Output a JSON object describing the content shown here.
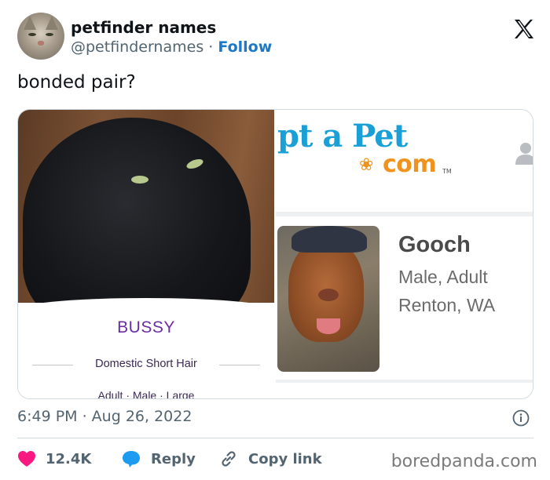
{
  "header": {
    "display_name": "petfinder names",
    "handle": "@petfindernames",
    "separator": "·",
    "follow_label": "Follow"
  },
  "tweet": {
    "text": "bonded pair?"
  },
  "media": {
    "left": {
      "pet_name": "BUSSY",
      "breed": "Domestic Short Hair",
      "attributes": "Adult  ·  Male  ·  Large"
    },
    "right": {
      "brand_partial": "pt a Pet",
      "brand_com": "com",
      "brand_tm": "TM",
      "pet_name": "Gooch",
      "pet_sex_age": "Male, Adult",
      "pet_location": "Renton, WA"
    }
  },
  "footer": {
    "timestamp": "6:49 PM · Aug 26, 2022",
    "likes_count": "12.4K",
    "reply_label": "Reply",
    "copy_link_label": "Copy link",
    "watermark": "boredpanda.com"
  },
  "colors": {
    "like": "#f91880",
    "reply": "#1d9bf0",
    "follow": "#1d78c8",
    "muted": "#536471",
    "bussy_purple": "#6a2ea4",
    "adopt_blue": "#1aa0d6",
    "adopt_orange": "#f0931e"
  },
  "icons": {
    "close": "x-logo-icon",
    "like": "heart-icon",
    "reply": "speech-bubble-icon",
    "copy_link": "link-icon",
    "info": "info-icon",
    "user": "user-silhouette-icon"
  }
}
